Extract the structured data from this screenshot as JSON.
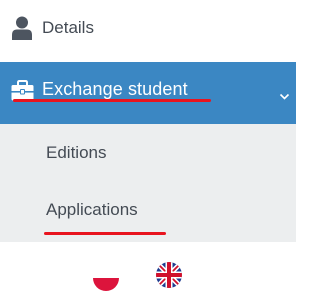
{
  "sidebar": {
    "details": {
      "label": "Details",
      "icon": "user-icon"
    },
    "exchange": {
      "label": "Exchange student",
      "icon": "briefcase-icon",
      "expanded": true,
      "active_color": "#3b87c3"
    },
    "submenu": [
      {
        "label": "Editions"
      },
      {
        "label": "Applications"
      }
    ],
    "highlight_color": "#e8141e"
  },
  "languages": [
    {
      "name": "pl-flag-icon"
    },
    {
      "name": "uk-flag-icon"
    }
  ]
}
